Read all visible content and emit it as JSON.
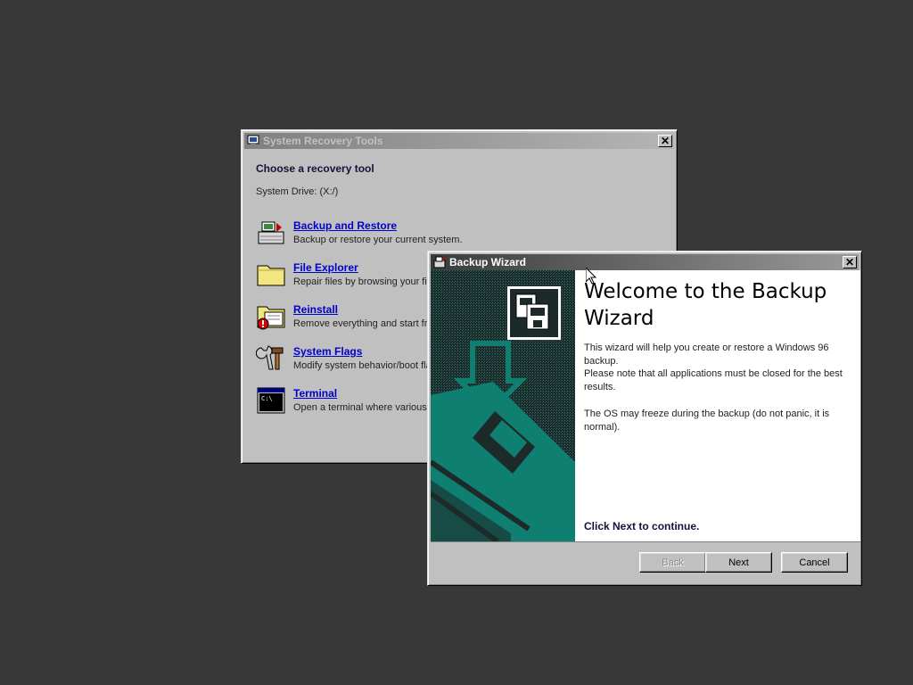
{
  "recovery_window": {
    "title": "System Recovery Tools",
    "heading": "Choose a recovery tool",
    "system_drive": "System Drive: (X:/)",
    "tools": [
      {
        "name": "Backup and Restore",
        "description": "Backup or restore your current system.",
        "icon": "backup-icon"
      },
      {
        "name": "File Explorer",
        "description": "Repair files by browsing your file s",
        "icon": "folder-icon"
      },
      {
        "name": "Reinstall",
        "description": "Remove everything and start fres",
        "icon": "reinstall-icon"
      },
      {
        "name": "System Flags",
        "description": "Modify system behavior/boot flag",
        "icon": "tools-icon"
      },
      {
        "name": "Terminal",
        "description": "Open a terminal where various co",
        "icon": "terminal-icon"
      }
    ]
  },
  "wizard": {
    "title": "Backup Wizard",
    "heading": "Welcome to the Backup Wizard",
    "paragraphs": [
      "This wizard will help you create or restore a Windows 96 backup.",
      "Please note that all applications must be closed for the best results.",
      "The OS may freeze during the backup (do not panic, it is normal)."
    ],
    "cta": "Click Next to continue.",
    "buttons": {
      "back": "Back",
      "next": "Next",
      "cancel": "Cancel"
    },
    "accent_color": "#0f7f72"
  }
}
